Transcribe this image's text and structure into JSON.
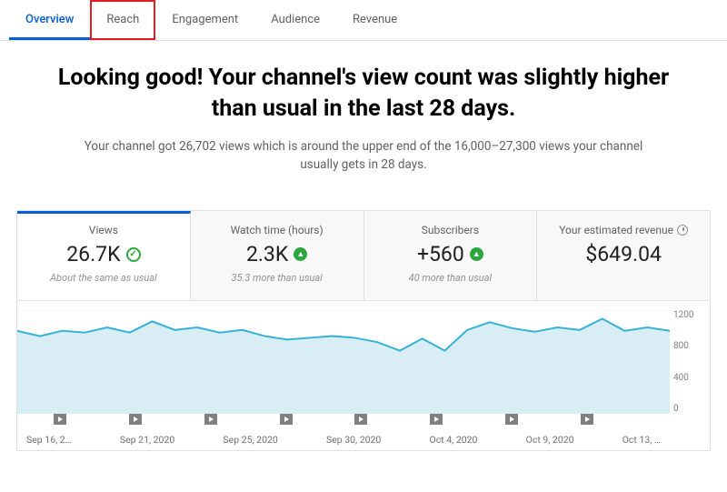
{
  "colors": {
    "accent": "#065fd4",
    "highlight_border": "#e31b23",
    "chart_line": "#35b2d6",
    "chart_fill": "#d8edf4",
    "positive": "#2ba640"
  },
  "tabs": {
    "items": [
      {
        "label": "Overview",
        "active": true
      },
      {
        "label": "Reach",
        "highlighted": true
      },
      {
        "label": "Engagement"
      },
      {
        "label": "Audience"
      },
      {
        "label": "Revenue"
      }
    ]
  },
  "hero": {
    "title": "Looking good! Your channel's view count was slightly higher than usual in the last 28 days.",
    "subtitle": "Your channel got 26,702 views which is around the upper end of the 16,000–27,300 views your channel usually gets in 28 days."
  },
  "cards": [
    {
      "title": "Views",
      "value": "26.7K",
      "icon": "check",
      "sub": "About the same as usual",
      "active": true
    },
    {
      "title": "Watch time (hours)",
      "value": "2.3K",
      "icon": "up",
      "sub": "35.3 more than usual"
    },
    {
      "title": "Subscribers",
      "value": "+560",
      "icon": "up",
      "sub": "40 more than usual"
    },
    {
      "title": "Your estimated revenue",
      "title_icon": "clock",
      "value": "$649.04",
      "sub": ""
    }
  ],
  "chart_data": {
    "type": "area",
    "title": "Views",
    "ylabel": "",
    "ylim": [
      0,
      1200
    ],
    "yticks": [
      1200,
      800,
      400,
      0
    ],
    "x_labels": [
      "Sep 16, 2…",
      "Sep 21, 2020",
      "Sep 25, 2020",
      "Sep 30, 2020",
      "Oct 4, 2020",
      "Oct 9, 2020",
      "Oct 13, …"
    ],
    "values": [
      960,
      900,
      960,
      940,
      1000,
      940,
      1070,
      970,
      1000,
      940,
      970,
      900,
      860,
      880,
      900,
      880,
      830,
      730,
      870,
      730,
      970,
      1060,
      990,
      950,
      1000,
      970,
      1100,
      960,
      1000,
      960
    ],
    "marker_count": 8
  }
}
